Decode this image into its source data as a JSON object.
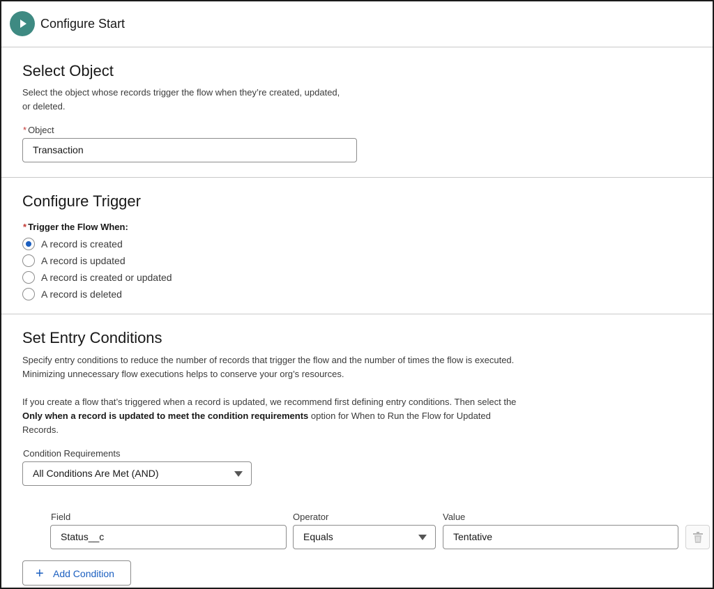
{
  "header": {
    "title": "Configure Start",
    "icon": "play-icon",
    "icon_color": "#3e8a82"
  },
  "select_object": {
    "title": "Select Object",
    "desc_line1": "Select the object whose records trigger the flow when they’re created, updated,",
    "desc_line2": "or deleted.",
    "required_mark": "*",
    "object_label": "Object",
    "object_value": "Transaction"
  },
  "configure_trigger": {
    "title": "Configure Trigger",
    "required_mark": "*",
    "label": "Trigger the Flow When:",
    "options": [
      {
        "label": "A record is created",
        "checked": true
      },
      {
        "label": "A record is updated",
        "checked": false
      },
      {
        "label": "A record is created or updated",
        "checked": false
      },
      {
        "label": "A record is deleted",
        "checked": false
      }
    ]
  },
  "entry_conditions": {
    "title": "Set Entry Conditions",
    "desc_line1": "Specify entry conditions to reduce the number of records that trigger the flow and the number of times the flow is executed.",
    "desc_line2": "Minimizing unnecessary flow executions helps to conserve your org’s resources.",
    "note_line1": "If you create a flow that’s triggered when a record is updated, we recommend first defining entry conditions. Then select the",
    "note_bold": "Only when a record is updated to meet the condition requirements",
    "note_line2_rest": " option for When to Run the Flow for Updated",
    "note_line3": "Records.",
    "requirements_label": "Condition Requirements",
    "requirements_value": "All Conditions Are Met (AND)",
    "field_label": "Field",
    "operator_label": "Operator",
    "value_label": "Value",
    "condition": {
      "field": "Status__c",
      "operator": "Equals",
      "value": "Tentative"
    },
    "add_label": "Add Condition"
  },
  "colors": {
    "accent": "#1b5fc0",
    "required": "#c23934",
    "border": "#8c8c8c"
  }
}
